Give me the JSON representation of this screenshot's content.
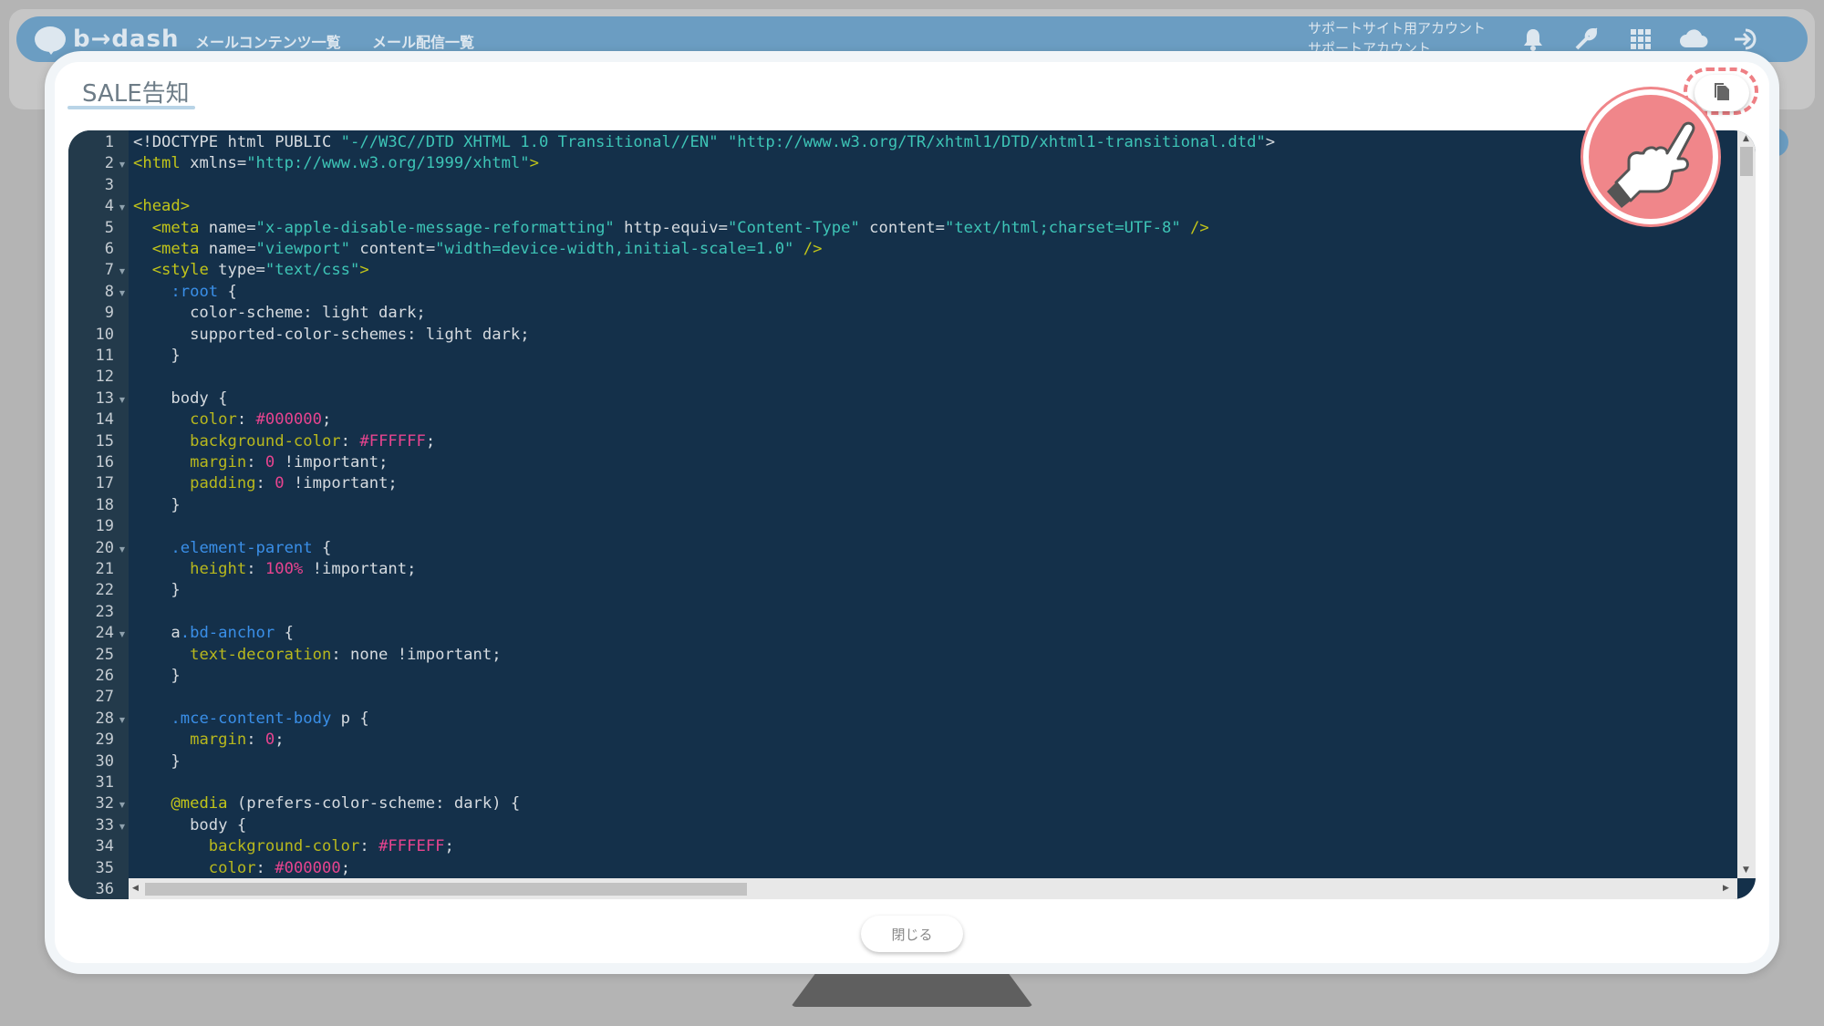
{
  "app": {
    "logo_text": "b→dash",
    "nav": [
      "メールコンテンツ一覧",
      "メール配信一覧"
    ],
    "account_lines": [
      "サポートサイト用アカウント",
      "サポートアカウント"
    ],
    "icons": [
      "bell-icon",
      "wrench-icon",
      "grid-icon",
      "cloud-icon",
      "logout-icon"
    ]
  },
  "modal": {
    "title": "SALE告知",
    "copy_icon": "copy-icon",
    "close_label": "閉じる"
  },
  "editor": {
    "line_numbers": [
      "1",
      "2",
      "3",
      "4",
      "5",
      "6",
      "7",
      "8",
      "9",
      "10",
      "11",
      "12",
      "13",
      "14",
      "15",
      "16",
      "17",
      "18",
      "19",
      "20",
      "21",
      "22",
      "23",
      "24",
      "25",
      "26",
      "27",
      "28",
      "29",
      "30",
      "31",
      "32",
      "33",
      "34",
      "35",
      "36"
    ],
    "fold_lines": [
      2,
      4,
      7,
      8,
      13,
      20,
      24,
      28,
      32,
      33
    ],
    "lines": [
      [
        [
          "tok-plain",
          "<!DOCTYPE html PUBLIC "
        ],
        [
          "tok-str",
          "\"-//W3C//DTD XHTML 1.0 Transitional//EN\""
        ],
        [
          "tok-plain",
          " "
        ],
        [
          "tok-str",
          "\"http://www.w3.org/TR/xhtml1/DTD/xhtml1-transitional.dtd\""
        ],
        [
          "tok-plain",
          ">"
        ]
      ],
      [
        [
          "tok-tag",
          "<html"
        ],
        [
          "tok-attr",
          " xmlns="
        ],
        [
          "tok-str",
          "\"http://www.w3.org/1999/xhtml\""
        ],
        [
          "tok-tag",
          ">"
        ]
      ],
      [],
      [
        [
          "tok-tag",
          "<head>"
        ]
      ],
      [
        [
          "tok-plain",
          "  "
        ],
        [
          "tok-tag",
          "<meta"
        ],
        [
          "tok-attr",
          " name="
        ],
        [
          "tok-str",
          "\"x-apple-disable-message-reformatting\""
        ],
        [
          "tok-attr",
          " http-equiv="
        ],
        [
          "tok-str",
          "\"Content-Type\""
        ],
        [
          "tok-attr",
          " content="
        ],
        [
          "tok-str",
          "\"text/html;charset=UTF-8\""
        ],
        [
          "tok-tag",
          " />"
        ]
      ],
      [
        [
          "tok-plain",
          "  "
        ],
        [
          "tok-tag",
          "<meta"
        ],
        [
          "tok-attr",
          " name="
        ],
        [
          "tok-str",
          "\"viewport\""
        ],
        [
          "tok-attr",
          " content="
        ],
        [
          "tok-str",
          "\"width=device-width,initial-scale=1.0\""
        ],
        [
          "tok-tag",
          " />"
        ]
      ],
      [
        [
          "tok-plain",
          "  "
        ],
        [
          "tok-tag",
          "<style"
        ],
        [
          "tok-attr",
          " type="
        ],
        [
          "tok-str",
          "\"text/css\""
        ],
        [
          "tok-tag",
          ">"
        ]
      ],
      [
        [
          "tok-plain",
          "    "
        ],
        [
          "tok-sel",
          ":root"
        ],
        [
          "tok-plain",
          " {"
        ]
      ],
      [
        [
          "tok-plain",
          "      color-scheme: light dark;"
        ]
      ],
      [
        [
          "tok-plain",
          "      supported-color-schemes: light dark;"
        ]
      ],
      [
        [
          "tok-plain",
          "    }"
        ]
      ],
      [],
      [
        [
          "tok-plain",
          "    body {"
        ]
      ],
      [
        [
          "tok-plain",
          "      "
        ],
        [
          "tok-prop",
          "color"
        ],
        [
          "tok-plain",
          ": "
        ],
        [
          "tok-num",
          "#000000"
        ],
        [
          "tok-plain",
          ";"
        ]
      ],
      [
        [
          "tok-plain",
          "      "
        ],
        [
          "tok-prop",
          "background-color"
        ],
        [
          "tok-plain",
          ": "
        ],
        [
          "tok-num",
          "#FFFFFF"
        ],
        [
          "tok-plain",
          ";"
        ]
      ],
      [
        [
          "tok-plain",
          "      "
        ],
        [
          "tok-prop",
          "margin"
        ],
        [
          "tok-plain",
          ": "
        ],
        [
          "tok-num",
          "0"
        ],
        [
          "tok-plain",
          " !important;"
        ]
      ],
      [
        [
          "tok-plain",
          "      "
        ],
        [
          "tok-prop",
          "padding"
        ],
        [
          "tok-plain",
          ": "
        ],
        [
          "tok-num",
          "0"
        ],
        [
          "tok-plain",
          " !important;"
        ]
      ],
      [
        [
          "tok-plain",
          "    }"
        ]
      ],
      [],
      [
        [
          "tok-plain",
          "    "
        ],
        [
          "tok-sel",
          ".element-parent"
        ],
        [
          "tok-plain",
          " {"
        ]
      ],
      [
        [
          "tok-plain",
          "      "
        ],
        [
          "tok-prop",
          "height"
        ],
        [
          "tok-plain",
          ": "
        ],
        [
          "tok-num",
          "100%"
        ],
        [
          "tok-plain",
          " !important;"
        ]
      ],
      [
        [
          "tok-plain",
          "    }"
        ]
      ],
      [],
      [
        [
          "tok-plain",
          "    a"
        ],
        [
          "tok-sel",
          ".bd-anchor"
        ],
        [
          "tok-plain",
          " {"
        ]
      ],
      [
        [
          "tok-plain",
          "      "
        ],
        [
          "tok-prop",
          "text-decoration"
        ],
        [
          "tok-plain",
          ": none !important;"
        ]
      ],
      [
        [
          "tok-plain",
          "    }"
        ]
      ],
      [],
      [
        [
          "tok-plain",
          "    "
        ],
        [
          "tok-sel",
          ".mce-content-body"
        ],
        [
          "tok-plain",
          " p {"
        ]
      ],
      [
        [
          "tok-plain",
          "      "
        ],
        [
          "tok-prop",
          "margin"
        ],
        [
          "tok-plain",
          ": "
        ],
        [
          "tok-num",
          "0"
        ],
        [
          "tok-plain",
          ";"
        ]
      ],
      [
        [
          "tok-plain",
          "    }"
        ]
      ],
      [],
      [
        [
          "tok-plain",
          "    "
        ],
        [
          "tok-at",
          "@media"
        ],
        [
          "tok-plain",
          " (prefers-color-scheme: dark) {"
        ]
      ],
      [
        [
          "tok-plain",
          "      body {"
        ]
      ],
      [
        [
          "tok-plain",
          "        "
        ],
        [
          "tok-prop",
          "background-color"
        ],
        [
          "tok-plain",
          ": "
        ],
        [
          "tok-num",
          "#FFFEFF"
        ],
        [
          "tok-plain",
          ";"
        ]
      ],
      [
        [
          "tok-plain",
          "        "
        ],
        [
          "tok-prop",
          "color"
        ],
        [
          "tok-plain",
          ": "
        ],
        [
          "tok-num",
          "#000000"
        ],
        [
          "tok-plain",
          ";"
        ]
      ],
      []
    ]
  },
  "colors": {
    "editor_bg": "#14304a",
    "gutter_bg": "#233a4b",
    "accent": "#6b9dc2",
    "highlight": "#f0868a"
  }
}
